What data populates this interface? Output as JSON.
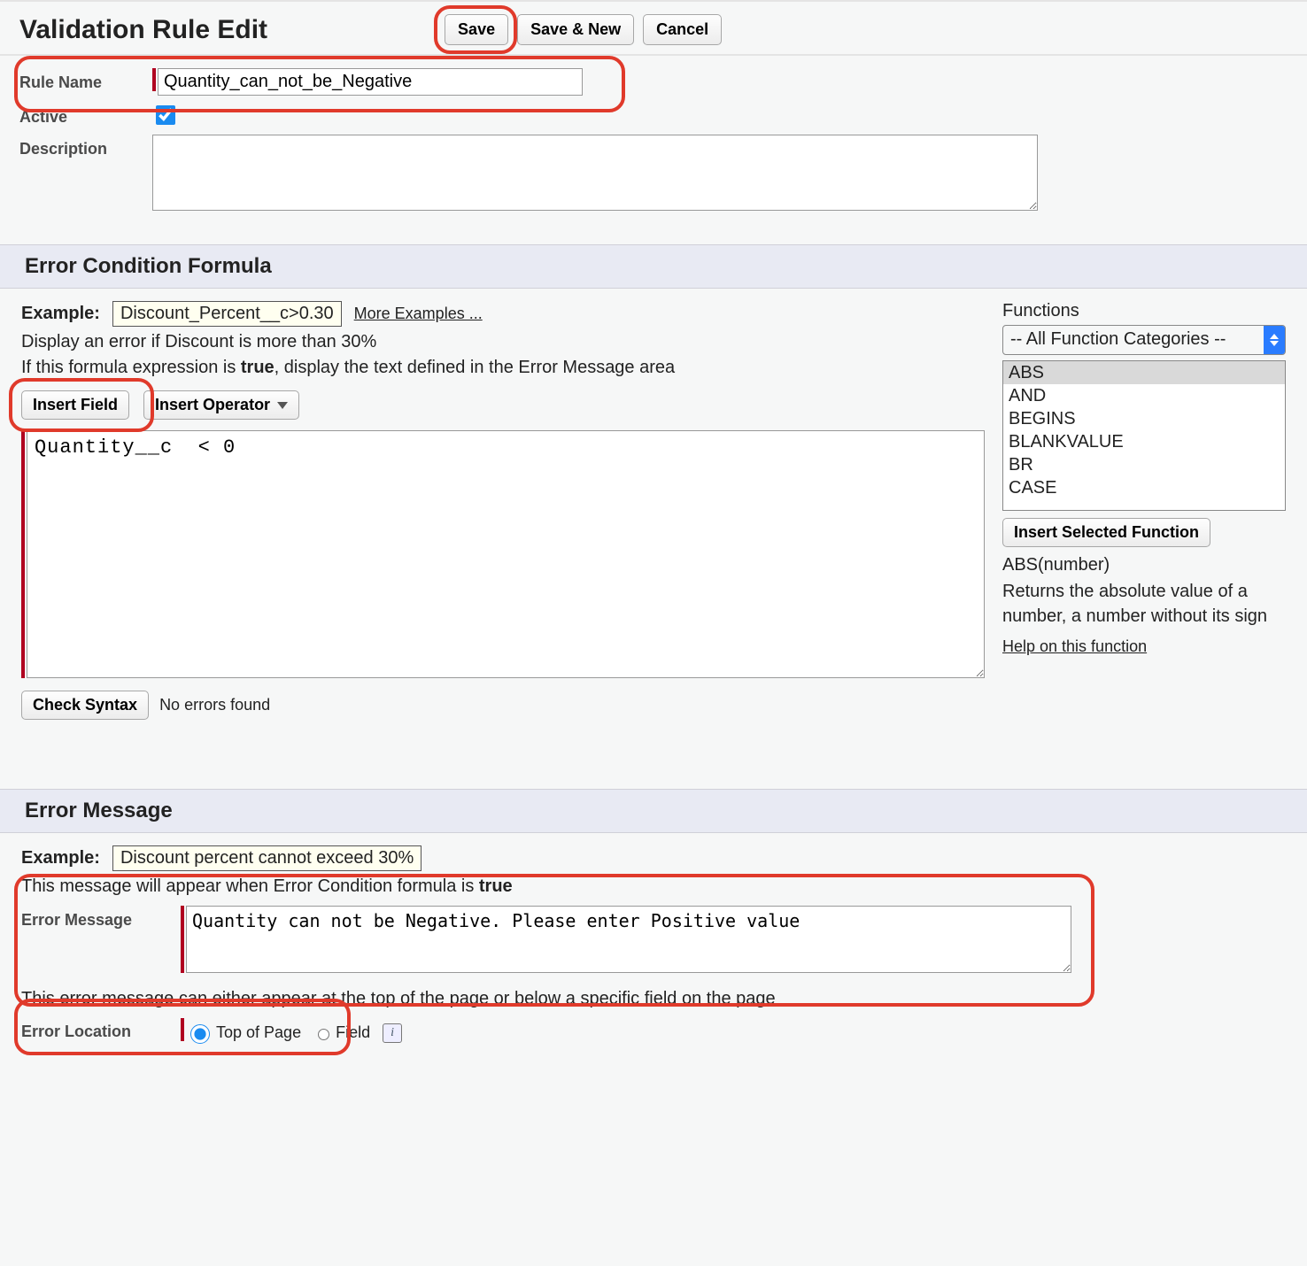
{
  "header": {
    "title": "Validation Rule Edit",
    "save": "Save",
    "saveNew": "Save & New",
    "cancel": "Cancel"
  },
  "form": {
    "ruleNameLabel": "Rule Name",
    "ruleNameValue": "Quantity_can_not_be_Negative",
    "activeLabel": "Active",
    "activeChecked": true,
    "descriptionLabel": "Description",
    "descriptionValue": ""
  },
  "formulaSection": {
    "heading": "Error Condition Formula",
    "exampleLabel": "Example:",
    "exampleCode": "Discount_Percent__c>0.30",
    "moreExamples": "More Examples ...",
    "exampleHint": "Display an error if Discount is more than 30%",
    "trueHintPrefix": "If this formula expression is ",
    "trueWord": "true",
    "trueHintSuffix": ", display the text defined in the Error Message area",
    "insertField": "Insert Field",
    "insertOperator": "Insert Operator",
    "formulaValue": "Quantity__c  < 0",
    "checkSyntax": "Check Syntax",
    "syntaxResult": "No errors found"
  },
  "functions": {
    "label": "Functions",
    "categorySelected": "-- All Function Categories --",
    "list": [
      "ABS",
      "AND",
      "BEGINS",
      "BLANKVALUE",
      "BR",
      "CASE"
    ],
    "selectedIndex": 0,
    "insertSelected": "Insert Selected Function",
    "signature": "ABS(number)",
    "description": "Returns the absolute value of a number, a number without its sign",
    "helpLink": "Help on this function"
  },
  "messageSection": {
    "heading": "Error Message",
    "exampleLabel": "Example:",
    "exampleText": "Discount percent cannot exceed 30%",
    "appearHintPrefix": "This message will appear when Error Condition formula is ",
    "appearHintBold": "true",
    "errorMessageLabel": "Error Message",
    "errorMessageValue": "Quantity can not be Negative. Please enter Positive value",
    "locationHint": "This error message can either appear at the top of the page or below a specific field on the page",
    "errorLocationLabel": "Error Location",
    "topOfPage": "Top of Page",
    "field": "Field"
  }
}
